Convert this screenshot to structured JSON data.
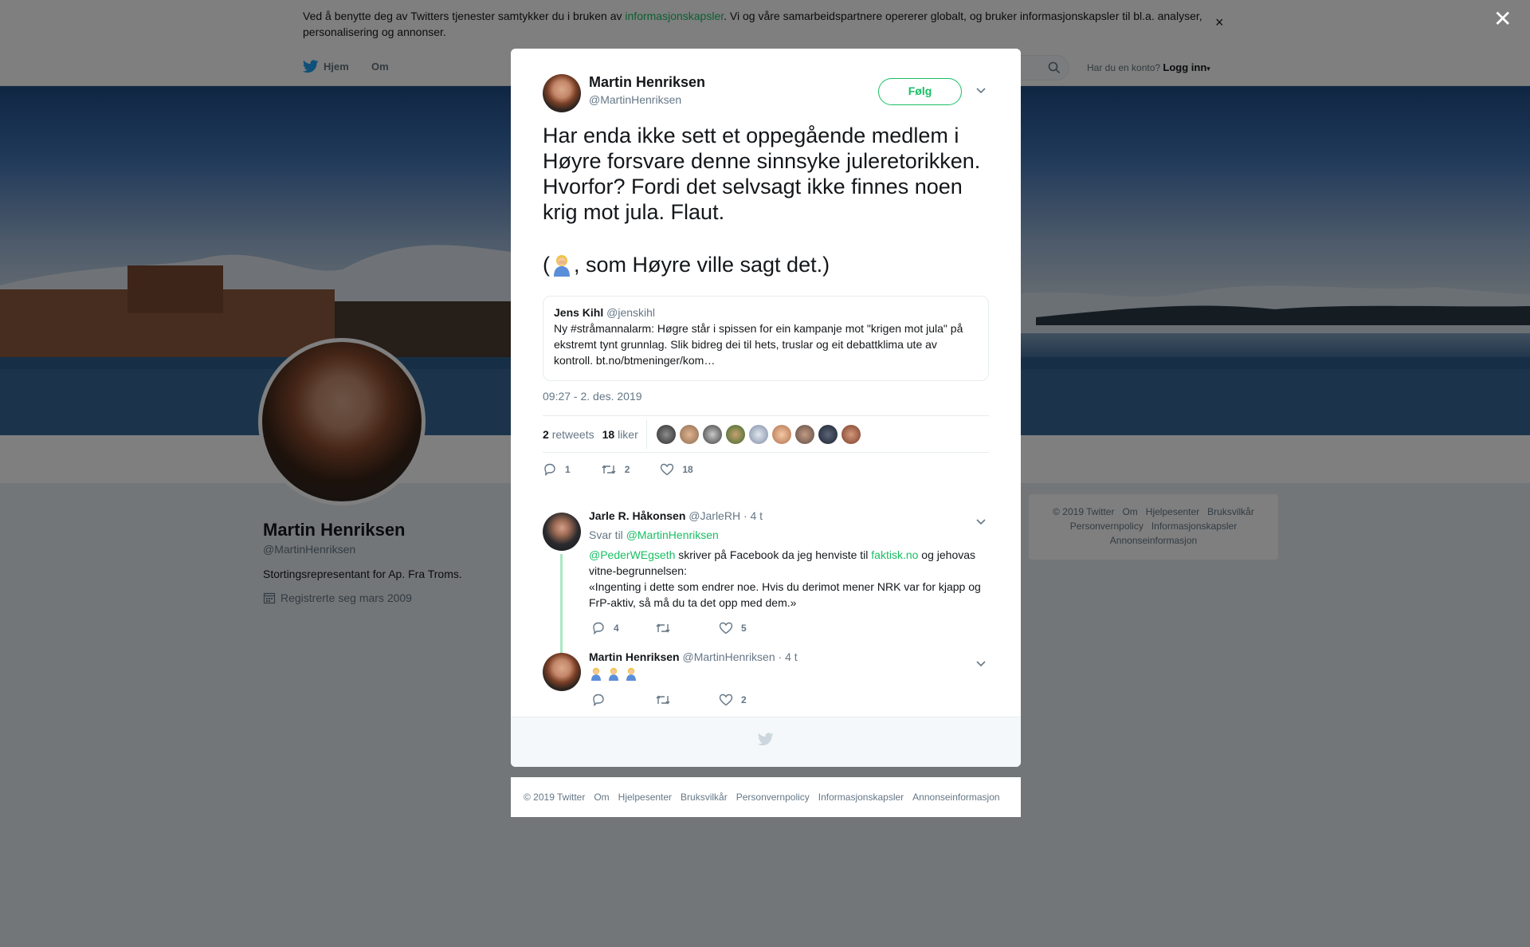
{
  "cookie": {
    "text_before": "Ved å benytte deg av Twitters tjenester samtykker du i bruken av ",
    "link": "informasjonskapsler",
    "text_after": ". Vi og våre samarbeidspartnere opererer globalt, og bruker informasjonskapsler til bl.a. analyser, personalisering og annonser.",
    "close": "×"
  },
  "nav": {
    "home": "Hjem",
    "about": "Om",
    "account_prompt": "Har du en konto?",
    "login": "Logg inn"
  },
  "profile": {
    "name": "Martin Henriksen",
    "handle": "@MartinHenriksen",
    "bio": "Stortingsrepresentant for Ap. Fra Troms.",
    "joined": "Registrerte seg mars 2009"
  },
  "side_footer": [
    "© 2019 Twitter",
    "Om",
    "Hjelpesenter",
    "Bruksvilkår",
    "Personvernpolicy",
    "Informasjonskapsler",
    "Annonseinformasjon"
  ],
  "overlay": {
    "close": "✕"
  },
  "tweet": {
    "name": "Martin Henriksen",
    "handle": "@MartinHenriksen",
    "follow": "Følg",
    "text": "Har enda ikke sett et oppegående medlem i Høyre forsvare denne sinnsyke juleretorikken. Hvorfor? Fordi det selvsagt ikke finnes noen krig mot jula. Flaut.",
    "text2_pre": "(",
    "text2_post": ", som Høyre ville sagt det.)",
    "quote": {
      "name": "Jens Kihl",
      "handle": "@jenskihl",
      "text": "Ny #stråmannalarm: Høgre står i spissen for ein kampanje mot \"krigen mot jula\" på ekstremt tynt grunnlag. Slik bidreg dei til hets, truslar og eit debattklima ute av kontroll. bt.no/btmeninger/kom…"
    },
    "time": "09:27 - 2. des. 2019",
    "retweets_count": "2",
    "retweets_label": "retweets",
    "likes_count": "18",
    "likes_label": "liker",
    "actions": {
      "replies": "1",
      "retweets": "2",
      "likes": "18"
    }
  },
  "replies": [
    {
      "name": "Jarle R. Håkonsen",
      "handle": "@JarleRH",
      "time": "· 4 t",
      "reply_to_label": "Svar til",
      "reply_to": "@MartinHenriksen",
      "mention": "@PederWEgseth",
      "text_a": " skriver på Facebook da jeg henviste til ",
      "link": "faktisk.no",
      "text_b": " og jehovas vitne-begrunnelsen:",
      "quote_text": "«Ingenting i dette som endrer noe. Hvis du derimot mener NRK var for kjapp og FrP-aktiv, så må du ta det opp med dem.»",
      "replies": "4",
      "retweets": "",
      "likes": "5"
    },
    {
      "name": "Martin Henriksen",
      "handle": "@MartinHenriksen",
      "time": "· 4 t",
      "replies": "",
      "retweets": "",
      "likes": "2"
    }
  ],
  "footer": [
    "© 2019 Twitter",
    "Om",
    "Hjelpesenter",
    "Bruksvilkår",
    "Personvernpolicy",
    "Informasjonskapsler",
    "Annonseinformasjon"
  ],
  "colors": {
    "accent": "#17bf63",
    "twitter_blue": "#1da1f2"
  }
}
